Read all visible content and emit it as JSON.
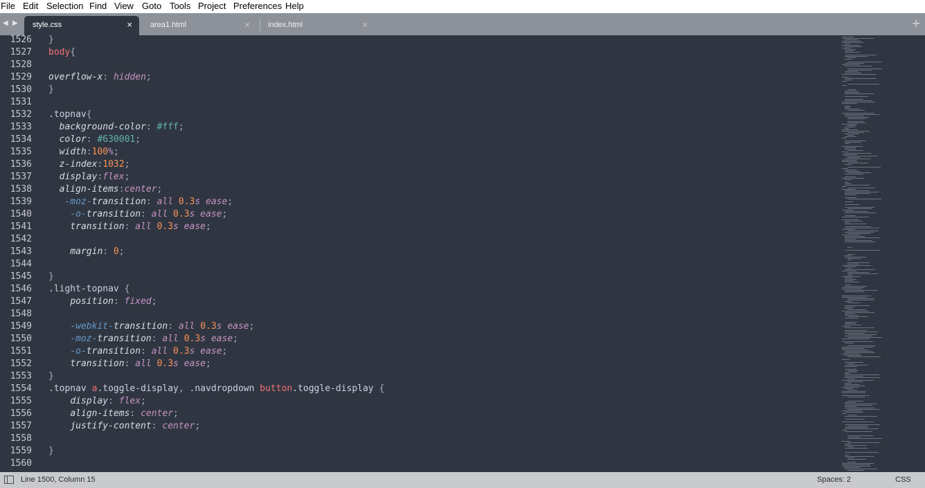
{
  "menu": [
    "File",
    "Edit",
    "Selection",
    "Find",
    "View",
    "Goto",
    "Tools",
    "Project",
    "Preferences",
    "Help"
  ],
  "tab_nav": {
    "prev_icon": "◀",
    "next_icon": "▶"
  },
  "tabs": [
    {
      "label": "style.css",
      "close": "×",
      "active": true
    },
    {
      "label": "area1.html",
      "close": "×",
      "active": false
    },
    {
      "label": "index.html",
      "close": "×",
      "active": false
    }
  ],
  "new_tab_icon": "+",
  "lines": [
    {
      "n": "1526",
      "tokens": [
        [
          "}",
          "pun"
        ]
      ]
    },
    {
      "n": "1527",
      "tokens": [
        [
          "body",
          "sel"
        ],
        [
          "{",
          "pun"
        ]
      ]
    },
    {
      "n": "1528",
      "tokens": []
    },
    {
      "n": "1529",
      "tokens": [
        [
          "overflow-x",
          "prop"
        ],
        [
          ": ",
          "pun"
        ],
        [
          "hidden",
          "val"
        ],
        [
          ";",
          "pun"
        ]
      ]
    },
    {
      "n": "1530",
      "tokens": [
        [
          "}",
          "pun"
        ]
      ]
    },
    {
      "n": "1531",
      "tokens": []
    },
    {
      "n": "1532",
      "tokens": [
        [
          ".topnav",
          "cls"
        ],
        [
          "{",
          "pun"
        ]
      ]
    },
    {
      "n": "1533",
      "tokens": [
        [
          "  ",
          "pun"
        ],
        [
          "background-color",
          "prop"
        ],
        [
          ": ",
          "pun"
        ],
        [
          "#fff",
          "hex"
        ],
        [
          ";",
          "pun"
        ]
      ]
    },
    {
      "n": "1534",
      "tokens": [
        [
          "  ",
          "pun"
        ],
        [
          "color",
          "prop"
        ],
        [
          ": ",
          "pun"
        ],
        [
          "#630001",
          "hex"
        ],
        [
          ";",
          "pun"
        ]
      ]
    },
    {
      "n": "1535",
      "tokens": [
        [
          "  ",
          "pun"
        ],
        [
          "width",
          "prop"
        ],
        [
          ":",
          "pun"
        ],
        [
          "100",
          "num"
        ],
        [
          "%",
          "val"
        ],
        [
          ";",
          "pun"
        ]
      ]
    },
    {
      "n": "1536",
      "tokens": [
        [
          "  ",
          "pun"
        ],
        [
          "z-index",
          "prop"
        ],
        [
          ":",
          "pun"
        ],
        [
          "1032",
          "num"
        ],
        [
          ";",
          "pun"
        ]
      ]
    },
    {
      "n": "1537",
      "tokens": [
        [
          "  ",
          "pun"
        ],
        [
          "display",
          "prop"
        ],
        [
          ":",
          "pun"
        ],
        [
          "flex",
          "val"
        ],
        [
          ";",
          "pun"
        ]
      ]
    },
    {
      "n": "1538",
      "tokens": [
        [
          "  ",
          "pun"
        ],
        [
          "align-items",
          "prop"
        ],
        [
          ":",
          "pun"
        ],
        [
          "center",
          "val"
        ],
        [
          ";",
          "pun"
        ]
      ]
    },
    {
      "n": "1539",
      "tokens": [
        [
          "   ",
          "pun"
        ],
        [
          "-moz-",
          "pre"
        ],
        [
          "transition",
          "prop"
        ],
        [
          ": ",
          "pun"
        ],
        [
          "all ",
          "val"
        ],
        [
          "0.3",
          "num"
        ],
        [
          "s ease",
          "val"
        ],
        [
          ";",
          "pun"
        ]
      ]
    },
    {
      "n": "1540",
      "tokens": [
        [
          "    ",
          "pun"
        ],
        [
          "-o-",
          "pre"
        ],
        [
          "transition",
          "prop"
        ],
        [
          ": ",
          "pun"
        ],
        [
          "all ",
          "val"
        ],
        [
          "0.3",
          "num"
        ],
        [
          "s ease",
          "val"
        ],
        [
          ";",
          "pun"
        ]
      ]
    },
    {
      "n": "1541",
      "tokens": [
        [
          "    ",
          "pun"
        ],
        [
          "transition",
          "prop"
        ],
        [
          ": ",
          "pun"
        ],
        [
          "all ",
          "val"
        ],
        [
          "0.3",
          "num"
        ],
        [
          "s ease",
          "val"
        ],
        [
          ";",
          "pun"
        ]
      ]
    },
    {
      "n": "1542",
      "tokens": []
    },
    {
      "n": "1543",
      "tokens": [
        [
          "    ",
          "pun"
        ],
        [
          "margin",
          "prop"
        ],
        [
          ": ",
          "pun"
        ],
        [
          "0",
          "num"
        ],
        [
          ";",
          "pun"
        ]
      ]
    },
    {
      "n": "1544",
      "tokens": []
    },
    {
      "n": "1545",
      "tokens": [
        [
          "}",
          "pun"
        ]
      ]
    },
    {
      "n": "1546",
      "tokens": [
        [
          ".light-topnav",
          "cls"
        ],
        [
          " {",
          "pun"
        ]
      ]
    },
    {
      "n": "1547",
      "tokens": [
        [
          "    ",
          "pun"
        ],
        [
          "position",
          "prop"
        ],
        [
          ": ",
          "pun"
        ],
        [
          "fixed",
          "val"
        ],
        [
          ";",
          "pun"
        ]
      ]
    },
    {
      "n": "1548",
      "tokens": []
    },
    {
      "n": "1549",
      "tokens": [
        [
          "    ",
          "pun"
        ],
        [
          "-webkit-",
          "pre"
        ],
        [
          "transition",
          "prop"
        ],
        [
          ": ",
          "pun"
        ],
        [
          "all ",
          "val"
        ],
        [
          "0.3",
          "num"
        ],
        [
          "s ease",
          "val"
        ],
        [
          ";",
          "pun"
        ]
      ]
    },
    {
      "n": "1550",
      "tokens": [
        [
          "    ",
          "pun"
        ],
        [
          "-moz-",
          "pre"
        ],
        [
          "transition",
          "prop"
        ],
        [
          ": ",
          "pun"
        ],
        [
          "all ",
          "val"
        ],
        [
          "0.3",
          "num"
        ],
        [
          "s ease",
          "val"
        ],
        [
          ";",
          "pun"
        ]
      ]
    },
    {
      "n": "1551",
      "tokens": [
        [
          "    ",
          "pun"
        ],
        [
          "-o-",
          "pre"
        ],
        [
          "transition",
          "prop"
        ],
        [
          ": ",
          "pun"
        ],
        [
          "all ",
          "val"
        ],
        [
          "0.3",
          "num"
        ],
        [
          "s ease",
          "val"
        ],
        [
          ";",
          "pun"
        ]
      ]
    },
    {
      "n": "1552",
      "tokens": [
        [
          "    ",
          "pun"
        ],
        [
          "transition",
          "prop"
        ],
        [
          ": ",
          "pun"
        ],
        [
          "all ",
          "val"
        ],
        [
          "0.3",
          "num"
        ],
        [
          "s ease",
          "val"
        ],
        [
          ";",
          "pun"
        ]
      ]
    },
    {
      "n": "1553",
      "tokens": [
        [
          "}",
          "pun"
        ]
      ]
    },
    {
      "n": "1554",
      "tokens": [
        [
          ".topnav ",
          "cls"
        ],
        [
          "a",
          "sel"
        ],
        [
          ".toggle-display",
          "cls"
        ],
        [
          ", ",
          "pun"
        ],
        [
          ".navdropdown ",
          "cls"
        ],
        [
          "button",
          "sel"
        ],
        [
          ".toggle-display",
          "cls"
        ],
        [
          " {",
          "pun"
        ]
      ]
    },
    {
      "n": "1555",
      "tokens": [
        [
          "    ",
          "pun"
        ],
        [
          "display",
          "prop"
        ],
        [
          ": ",
          "pun"
        ],
        [
          "flex",
          "val"
        ],
        [
          ";",
          "pun"
        ]
      ]
    },
    {
      "n": "1556",
      "tokens": [
        [
          "    ",
          "pun"
        ],
        [
          "align-items",
          "prop"
        ],
        [
          ": ",
          "pun"
        ],
        [
          "center",
          "val"
        ],
        [
          ";",
          "pun"
        ]
      ]
    },
    {
      "n": "1557",
      "tokens": [
        [
          "    ",
          "pun"
        ],
        [
          "justify-content",
          "prop"
        ],
        [
          ": ",
          "pun"
        ],
        [
          "center",
          "val"
        ],
        [
          ";",
          "pun"
        ]
      ]
    },
    {
      "n": "1558",
      "tokens": []
    },
    {
      "n": "1559",
      "tokens": [
        [
          "}",
          "pun"
        ]
      ]
    },
    {
      "n": "1560",
      "tokens": []
    }
  ],
  "status": {
    "position": "Line 1500, Column 15",
    "indent": "Spaces: 2",
    "syntax": "CSS"
  }
}
